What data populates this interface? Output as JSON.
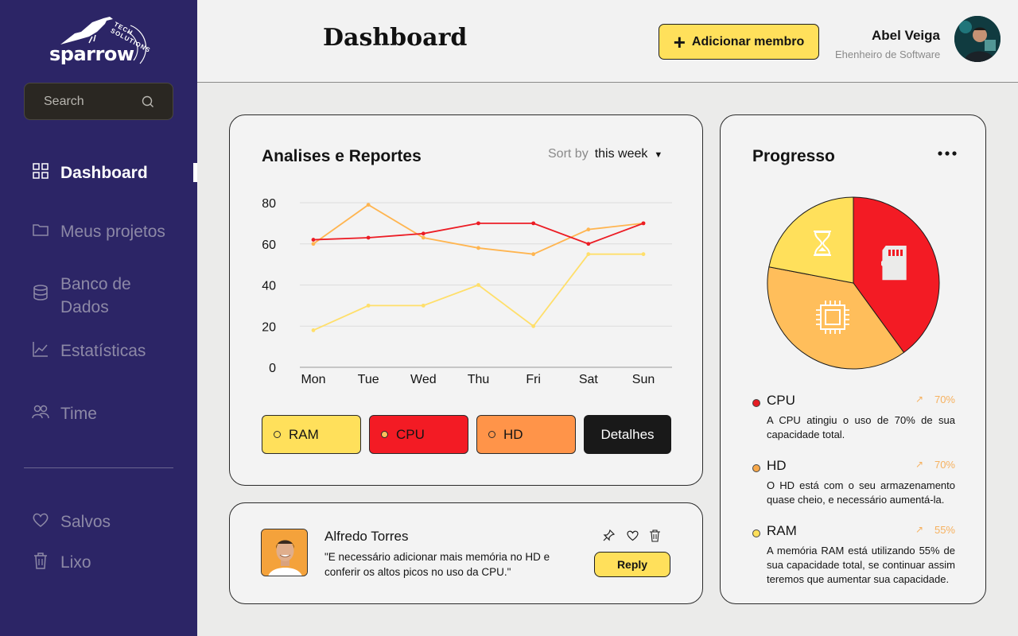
{
  "brand": {
    "name": "sparrow",
    "tagline": "TECH SOLUTIONS"
  },
  "search": {
    "placeholder": "Search"
  },
  "nav": {
    "items": [
      {
        "label": "Dashboard",
        "icon": "grid-icon",
        "active": true
      },
      {
        "label": "Meus projetos",
        "icon": "folder-icon"
      },
      {
        "label": "Banco de Dados",
        "icon": "database-icon"
      },
      {
        "label": "Estatísticas",
        "icon": "chart-line-icon"
      },
      {
        "label": "Time",
        "icon": "team-icon"
      }
    ],
    "bottom": [
      {
        "label": "Salvos",
        "icon": "heart-icon"
      },
      {
        "label": "Lixo",
        "icon": "trash-icon"
      }
    ]
  },
  "header": {
    "title": "Dashboard",
    "add_button": "Adicionar membro",
    "user": {
      "name": "Abel Veiga",
      "role": "Ehenheiro de Software"
    }
  },
  "analytics": {
    "title": "Analises e Reportes",
    "sort_label": "Sort by",
    "sort_value": "this week",
    "legend": [
      {
        "label": "RAM",
        "color": "#ffe05b"
      },
      {
        "label": "CPU",
        "color": "#f31b24"
      },
      {
        "label": "HD",
        "color": "#ff9449"
      }
    ],
    "details_button": "Detalhes"
  },
  "chart_data": {
    "type": "line",
    "categories": [
      "Mon",
      "Tue",
      "Wed",
      "Thu",
      "Fri",
      "Sat",
      "Sun"
    ],
    "ylim": [
      0,
      80
    ],
    "yticks": [
      0,
      20,
      40,
      60,
      80
    ],
    "grid": true,
    "series": [
      {
        "name": "CPU",
        "color": "#ec1c24",
        "values": [
          62,
          63,
          65,
          70,
          70,
          60,
          70
        ]
      },
      {
        "name": "HD",
        "color": "#ffb550",
        "values": [
          60,
          79,
          63,
          58,
          55,
          67,
          70
        ]
      },
      {
        "name": "RAM",
        "color": "#ffdf6a",
        "values": [
          18,
          30,
          30,
          40,
          20,
          55,
          55
        ]
      }
    ]
  },
  "comment": {
    "name": "Alfredo Torres",
    "text": "\"E necessário adicionar mais memória no HD e conferir os altos picos no uso da CPU.\"",
    "reply_button": "Reply"
  },
  "progress": {
    "title": "Progresso",
    "pie": [
      {
        "name": "CPU",
        "value": 40,
        "color": "#f31b24",
        "icon": "sd-card-icon"
      },
      {
        "name": "HD",
        "value": 38,
        "color": "#ffbe5b",
        "icon": "chip-icon"
      },
      {
        "name": "RAM",
        "value": 22,
        "color": "#ffe05b",
        "icon": "hourglass-icon"
      }
    ],
    "stats": [
      {
        "name": "CPU",
        "percent": "70%",
        "color": "#e51c23",
        "description": "A CPU atingiu o uso de 70% de sua capacidade total."
      },
      {
        "name": "HD",
        "percent": "70%",
        "color": "#f7a84a",
        "description": "O HD está com o seu armazenamento quase cheio, e necessário aumentá-la."
      },
      {
        "name": "RAM",
        "percent": "55%",
        "color": "#ffe05b",
        "description": "A memória RAM está utilizando 55% de sua capacidade total, se continuar assim teremos que aumentar sua capacidade."
      }
    ]
  }
}
